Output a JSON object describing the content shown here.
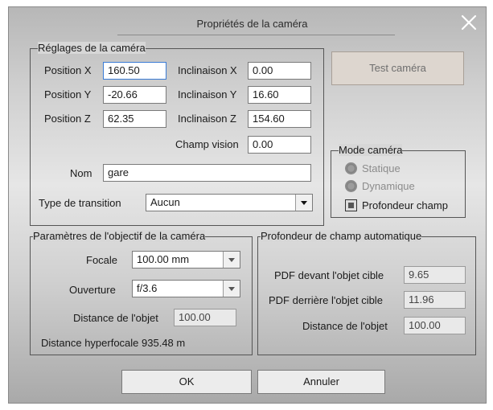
{
  "window": {
    "title": "Propriétés de la caméra"
  },
  "settings": {
    "legend": "Réglages de la caméra",
    "pos_x": {
      "label": "Position X",
      "value": "160.50"
    },
    "pos_y": {
      "label": "Position Y",
      "value": "-20.66"
    },
    "pos_z": {
      "label": "Position Z",
      "value": "62.35"
    },
    "incl_x": {
      "label": "Inclinaison X",
      "value": "0.00"
    },
    "incl_y": {
      "label": "Inclinaison Y",
      "value": "16.60"
    },
    "incl_z": {
      "label": "Inclinaison Z",
      "value": "154.60"
    },
    "fov": {
      "label": "Champ vision",
      "value": "0.00"
    },
    "name": {
      "label": "Nom",
      "value": "gare"
    },
    "transition": {
      "label": "Type de transition",
      "value": "Aucun"
    }
  },
  "test_button": {
    "label": "Test caméra"
  },
  "mode": {
    "legend": "Mode caméra",
    "static": "Statique",
    "dynamic": "Dynamique",
    "dof": "Profondeur champ"
  },
  "lens": {
    "legend": "Paramètres de l'objectif de la caméra",
    "focal": {
      "label": "Focale",
      "value": "100.00 mm"
    },
    "aperture": {
      "label": "Ouverture",
      "value": "f/3.6"
    },
    "distance": {
      "label": "Distance de l'objet",
      "value": "100.00"
    },
    "hyperfocal": "Distance hyperfocale  935.48 m"
  },
  "autodof": {
    "legend": "Profondeur de champ automatique",
    "front": {
      "label": "PDF devant l'objet cible",
      "value": "9.65"
    },
    "back": {
      "label": "PDF derrière l'objet cible",
      "value": "11.96"
    },
    "distance": {
      "label": "Distance de l'objet",
      "value": "100.00"
    }
  },
  "buttons": {
    "ok": "OK",
    "cancel": "Annuler"
  },
  "colors": {
    "focus_border": "#3a7bd5",
    "test_button_bg": "#ddd6cf"
  }
}
